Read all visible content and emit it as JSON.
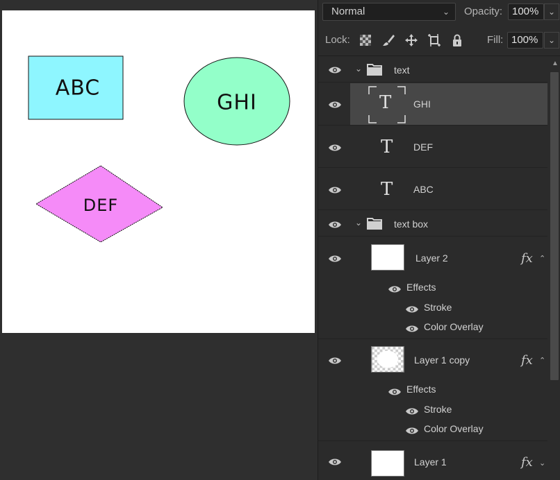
{
  "canvas": {
    "shapes": [
      {
        "kind": "rect",
        "label": "ABC",
        "fill": "#8ef6ff"
      },
      {
        "kind": "ellipse",
        "label": "GHI",
        "fill": "#93ffc9"
      },
      {
        "kind": "diamond",
        "label": "DEF",
        "fill": "#f58bf8"
      }
    ]
  },
  "toolbar": {
    "blend_mode": "Normal",
    "opacity_label": "Opacity:",
    "opacity_value": "100%",
    "lock_label": "Lock:",
    "fill_label": "Fill:",
    "fill_value": "100%"
  },
  "layers": {
    "group_text": "text",
    "layer_ghi": "GHI",
    "layer_def": "DEF",
    "layer_abc": "ABC",
    "group_textbox": "text box",
    "layer2": "Layer 2",
    "layer2_effects": "Effects",
    "layer2_stroke": "Stroke",
    "layer2_overlay": "Color Overlay",
    "layer1copy": "Layer 1 copy",
    "layer1copy_effects": "Effects",
    "layer1copy_stroke": "Stroke",
    "layer1copy_overlay": "Color Overlay",
    "layer1": "Layer 1",
    "fx_symbol": "fx"
  },
  "colors": {
    "selected_row": "#474747",
    "panel_bg": "#2b2b2b"
  }
}
